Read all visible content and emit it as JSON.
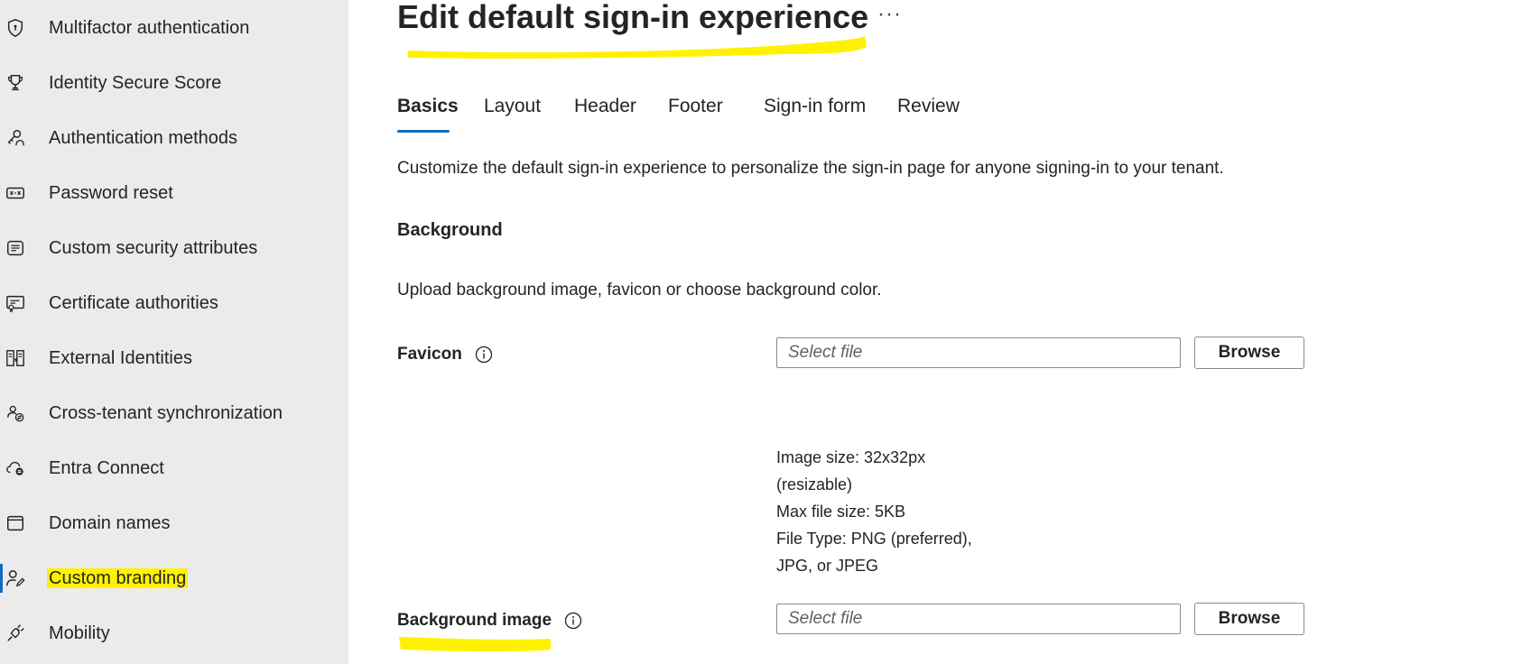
{
  "sidebar": {
    "items": [
      {
        "label": "Multifactor authentication",
        "icon": "shield-icon"
      },
      {
        "label": "Identity Secure Score",
        "icon": "trophy-icon"
      },
      {
        "label": "Authentication methods",
        "icon": "key-person-icon"
      },
      {
        "label": "Password reset",
        "icon": "password-icon"
      },
      {
        "label": "Custom security attributes",
        "icon": "attributes-icon"
      },
      {
        "label": "Certificate authorities",
        "icon": "certificate-icon"
      },
      {
        "label": "External Identities",
        "icon": "external-identities-icon"
      },
      {
        "label": "Cross-tenant synchronization",
        "icon": "people-sync-icon"
      },
      {
        "label": "Entra Connect",
        "icon": "cloud-sync-icon"
      },
      {
        "label": "Domain names",
        "icon": "window-icon"
      },
      {
        "label": "Custom branding",
        "icon": "person-edit-icon"
      },
      {
        "label": "Mobility",
        "icon": "plug-icon"
      }
    ],
    "active_item": "Custom branding",
    "highlight_color": "#fff200"
  },
  "header": {
    "title": "Edit default sign-in experience",
    "more_label": "···"
  },
  "tabs": [
    {
      "label": "Basics",
      "active": true
    },
    {
      "label": "Layout",
      "active": false
    },
    {
      "label": "Header",
      "active": false
    },
    {
      "label": "Footer",
      "active": false
    },
    {
      "label": "Sign-in form",
      "active": false
    },
    {
      "label": "Review",
      "active": false
    }
  ],
  "main": {
    "description": "Customize the default sign-in experience to personalize the sign-in page for anyone signing-in to your tenant.",
    "section_heading": "Background",
    "section_description": "Upload background image, favicon or choose background color.",
    "favicon": {
      "label": "Favicon",
      "placeholder": "Select file",
      "browse_label": "Browse",
      "requirements": [
        "Image size: 32x32px",
        "(resizable)",
        "Max file size: 5KB",
        "File Type: PNG (preferred),",
        "JPG, or JPEG"
      ]
    },
    "background_image": {
      "label": "Background image",
      "placeholder": "Select file",
      "browse_label": "Browse"
    }
  },
  "colors": {
    "accent": "#0f6cbd",
    "highlight": "#fff200",
    "sidebar_bg": "#ebebeb"
  }
}
